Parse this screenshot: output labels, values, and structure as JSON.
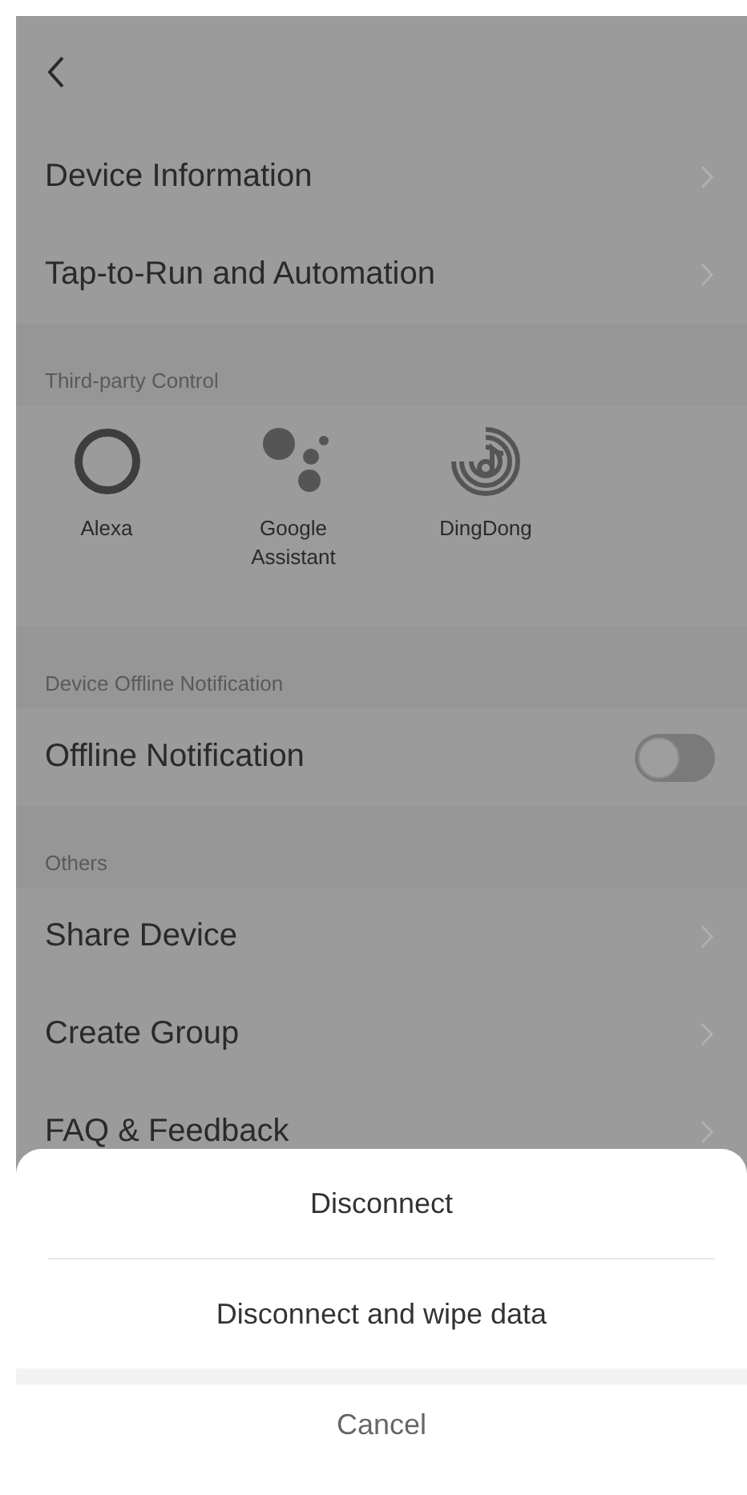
{
  "menu_items": [
    {
      "label": "Device Information"
    },
    {
      "label": "Tap-to-Run and Automation"
    }
  ],
  "third_party": {
    "header": "Third-party Control",
    "services": [
      {
        "kind": "alexa",
        "label": "Alexa"
      },
      {
        "kind": "assistant",
        "label": "Google\nAssistant"
      },
      {
        "kind": "dingdong",
        "label": "DingDong"
      }
    ]
  },
  "offline": {
    "header": "Device Offline Notification",
    "label": "Offline Notification",
    "on": false
  },
  "others": {
    "header": "Others",
    "items": [
      {
        "label": "Share Device"
      },
      {
        "label": "Create Group"
      },
      {
        "label": "FAQ & Feedback"
      }
    ]
  },
  "action_sheet": {
    "actions": [
      "Disconnect",
      "Disconnect and wipe data"
    ],
    "cancel": "Cancel"
  }
}
